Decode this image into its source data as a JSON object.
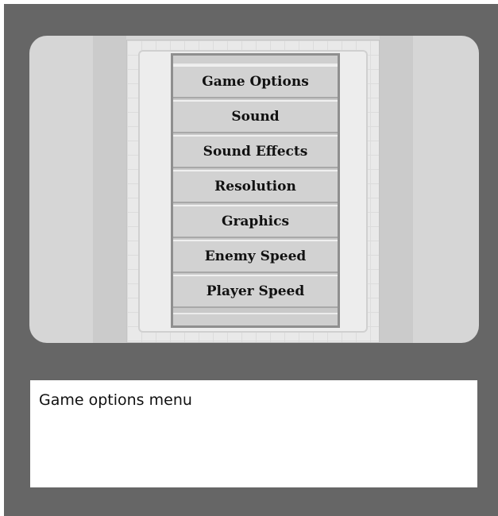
{
  "menu": {
    "items": [
      {
        "label": "Game Options"
      },
      {
        "label": "Sound"
      },
      {
        "label": "Sound Effects"
      },
      {
        "label": "Resolution"
      },
      {
        "label": "Graphics"
      },
      {
        "label": "Enemy Speed"
      },
      {
        "label": "Player Speed"
      }
    ]
  },
  "caption": {
    "text": "Game options menu"
  },
  "colors": {
    "frame": "#666666",
    "screen": "#d6d6d6",
    "menu_item": "#d2d2d2",
    "caption_bg": "#ffffff"
  }
}
